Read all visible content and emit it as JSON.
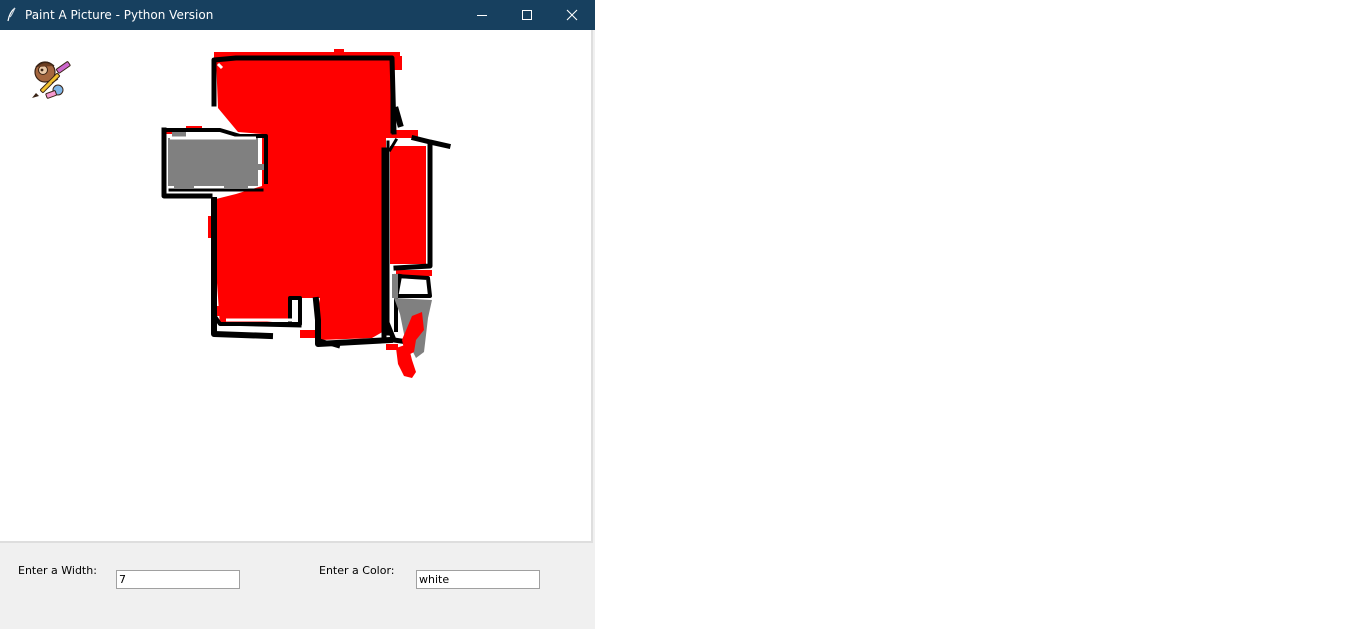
{
  "window": {
    "title": "Paint A Picture - Python Version",
    "titlebar_color": "#17405f"
  },
  "canvas": {
    "background": "#ffffff",
    "stroke_colors": [
      "#000000",
      "#ff0000",
      "#808080",
      "#ffffff"
    ]
  },
  "controls": {
    "width_label": "Enter a Width:",
    "width_value": "7",
    "color_label": "Enter a Color:",
    "color_value": "white"
  },
  "icons": {
    "app": "feather-icon",
    "mascot": "painter-mascot-icon",
    "minimize": "minimize-icon",
    "maximize": "maximize-icon",
    "close": "close-icon"
  }
}
